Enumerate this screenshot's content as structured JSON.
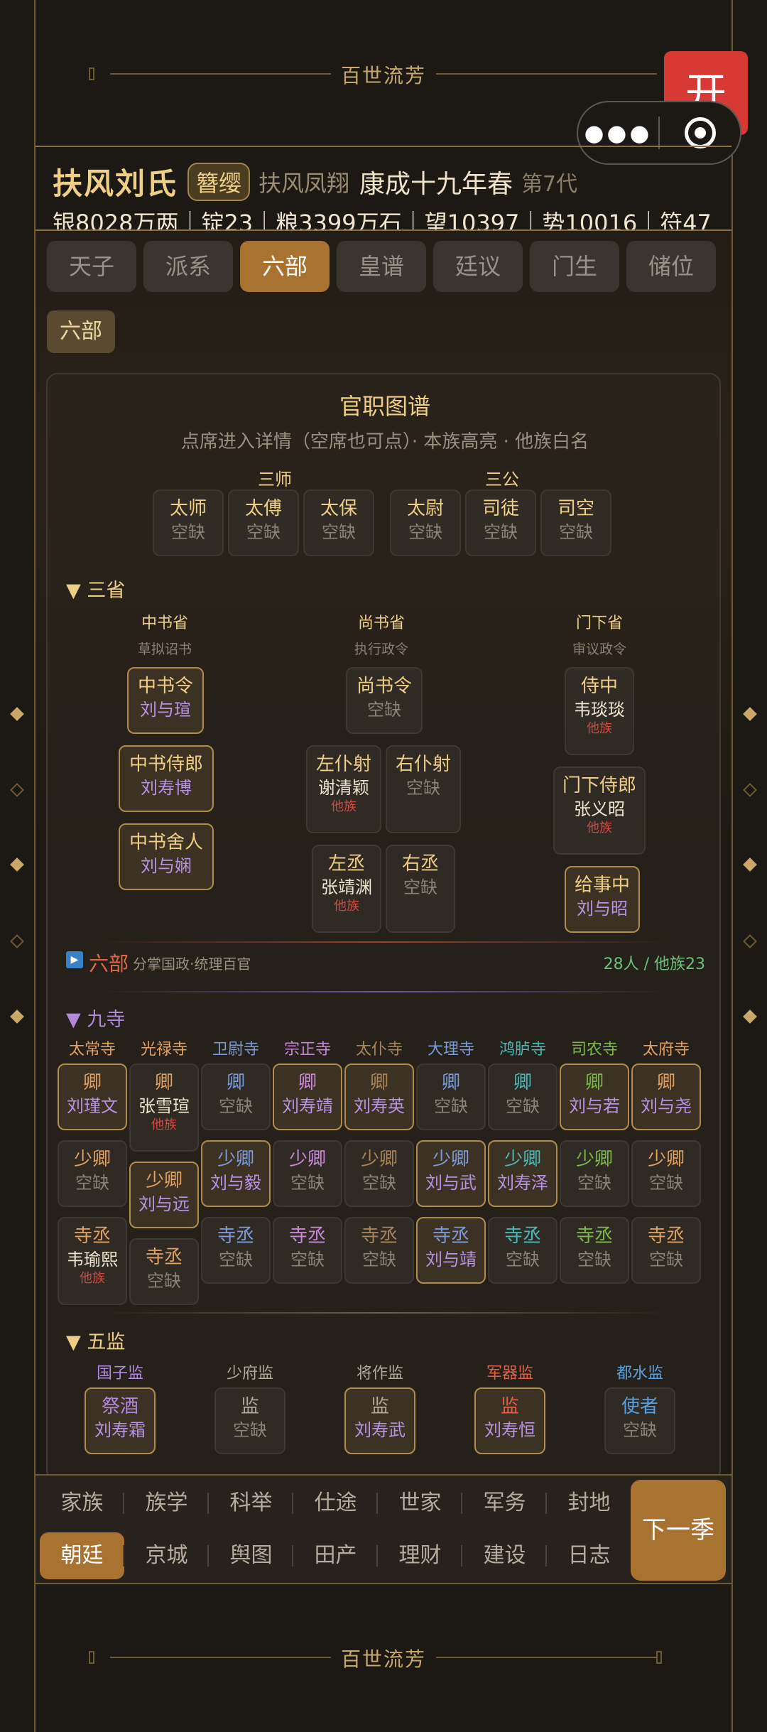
{
  "banner": {
    "top": "百世流芳",
    "bottom": "百世流芳"
  },
  "open_button": "开",
  "header": {
    "clan": "扶风刘氏",
    "title_badge": "簪缨",
    "family_tag": "扶风凤翔",
    "era": "康成十九年春",
    "generation": "第7代",
    "resources": "银8028万两｜锭23｜粮3399万石｜望10397｜势10016｜符47"
  },
  "tabs": [
    "天子",
    "派系",
    "六部",
    "皇谱",
    "廷议",
    "门生",
    "储位"
  ],
  "active_tab": "六部",
  "subtab": "六部",
  "card": {
    "title": "官职图谱",
    "desc": "点席进入详情（空席也可点）· 本族高亮 · 他族白名"
  },
  "sanshi": {
    "label": "三师",
    "items": [
      {
        "n": "太师",
        "h": "空缺"
      },
      {
        "n": "太傅",
        "h": "空缺"
      },
      {
        "n": "太保",
        "h": "空缺"
      }
    ]
  },
  "sangong": {
    "label": "三公",
    "items": [
      {
        "n": "太尉",
        "h": "空缺"
      },
      {
        "n": "司徒",
        "h": "空缺"
      },
      {
        "n": "司空",
        "h": "空缺"
      }
    ]
  },
  "sansheng": {
    "label": "▼ 三省",
    "zhongshu": {
      "name": "中书省",
      "sub": "草拟诏书",
      "posts": [
        {
          "n": "中书令",
          "h": "刘与瑄"
        },
        {
          "n": "中书侍郎",
          "h": "刘寿博"
        },
        {
          "n": "中书舍人",
          "h": "刘与娴"
        }
      ]
    },
    "shangshu": {
      "name": "尚书省",
      "sub": "执行政令",
      "ling": {
        "n": "尚书令",
        "h": "空缺"
      },
      "left": [
        {
          "n": "左仆射",
          "h": "谢清颖",
          "o": "他族"
        },
        {
          "n": "左丞",
          "h": "张靖渊",
          "o": "他族"
        }
      ],
      "right": [
        {
          "n": "右仆射",
          "h": "空缺"
        },
        {
          "n": "右丞",
          "h": "空缺"
        }
      ]
    },
    "menxia": {
      "name": "门下省",
      "sub": "审议政令",
      "posts": [
        {
          "n": "侍中",
          "h": "韦琰琰",
          "o": "他族"
        },
        {
          "n": "门下侍郎",
          "h": "张义昭",
          "o": "他族"
        },
        {
          "n": "给事中",
          "h": "刘与昭"
        }
      ]
    }
  },
  "liubu_bar": {
    "title": "六部",
    "sub": "分掌国政·统理百官",
    "count": "28人 / 他族23"
  },
  "jiusi": {
    "label": "▼ 九寺",
    "cols": [
      {
        "name": "太常寺",
        "color": "#e0a060",
        "rows": [
          {
            "n": "卿",
            "h": "刘瑾文"
          },
          {
            "n": "少卿",
            "h": "空缺"
          },
          {
            "n": "寺丞",
            "h": "韦瑜熙",
            "o": "他族"
          }
        ]
      },
      {
        "name": "光禄寺",
        "color": "#e0a060",
        "rows": [
          {
            "n": "卿",
            "h": "张雪瑄",
            "o": "他族"
          },
          {
            "n": "少卿",
            "h": "刘与远"
          },
          {
            "n": "寺丞",
            "h": "空缺"
          }
        ]
      },
      {
        "name": "卫尉寺",
        "color": "#7a9ad8",
        "rows": [
          {
            "n": "卿",
            "h": "空缺"
          },
          {
            "n": "少卿",
            "h": "刘与毅"
          },
          {
            "n": "寺丞",
            "h": "空缺"
          }
        ]
      },
      {
        "name": "宗正寺",
        "color": "#c888d8",
        "rows": [
          {
            "n": "卿",
            "h": "刘寿靖"
          },
          {
            "n": "少卿",
            "h": "空缺"
          },
          {
            "n": "寺丞",
            "h": "空缺"
          }
        ]
      },
      {
        "name": "太仆寺",
        "color": "#a88458",
        "rows": [
          {
            "n": "卿",
            "h": "刘寿英"
          },
          {
            "n": "少卿",
            "h": "空缺"
          },
          {
            "n": "寺丞",
            "h": "空缺"
          }
        ]
      },
      {
        "name": "大理寺",
        "color": "#7a9ad8",
        "rows": [
          {
            "n": "卿",
            "h": "空缺"
          },
          {
            "n": "少卿",
            "h": "刘与武"
          },
          {
            "n": "寺丞",
            "h": "刘与靖"
          }
        ]
      },
      {
        "name": "鸿胪寺",
        "color": "#48b8b8",
        "rows": [
          {
            "n": "卿",
            "h": "空缺"
          },
          {
            "n": "少卿",
            "h": "刘寿泽"
          },
          {
            "n": "寺丞",
            "h": "空缺"
          }
        ]
      },
      {
        "name": "司农寺",
        "color": "#7ab848",
        "rows": [
          {
            "n": "卿",
            "h": "刘与若"
          },
          {
            "n": "少卿",
            "h": "空缺"
          },
          {
            "n": "寺丞",
            "h": "空缺"
          }
        ]
      },
      {
        "name": "太府寺",
        "color": "#e0a060",
        "rows": [
          {
            "n": "卿",
            "h": "刘与尧"
          },
          {
            "n": "少卿",
            "h": "空缺"
          },
          {
            "n": "寺丞",
            "h": "空缺"
          }
        ]
      }
    ]
  },
  "wujian": {
    "label": "▼ 五监",
    "cols": [
      {
        "name": "国子监",
        "color": "#b088e0",
        "post": {
          "n": "祭酒",
          "h": "刘寿霜"
        }
      },
      {
        "name": "少府监",
        "color": "#b0a898",
        "post": {
          "n": "监",
          "h": "空缺"
        }
      },
      {
        "name": "将作监",
        "color": "#b0a898",
        "post": {
          "n": "监",
          "h": "刘寿武"
        }
      },
      {
        "name": "军器监",
        "color": "#e06048",
        "post": {
          "n": "监",
          "h": "刘寿恒"
        }
      },
      {
        "name": "都水监",
        "color": "#5aa0e0",
        "post": {
          "n": "使者",
          "h": "空缺"
        }
      }
    ]
  },
  "nav": {
    "row1": [
      "家族",
      "族学",
      "科举",
      "仕途",
      "世家",
      "军务",
      "封地"
    ],
    "row2": [
      "朝廷",
      "京城",
      "舆图",
      "田产",
      "理财",
      "建设",
      "日志"
    ],
    "active": "朝廷",
    "next": "下一季"
  },
  "colors": {
    "gold": "#efcf86",
    "accent": "#a87230",
    "vacant": "#8a8278",
    "other": "#d04a40",
    "clan": "#b892e4"
  }
}
